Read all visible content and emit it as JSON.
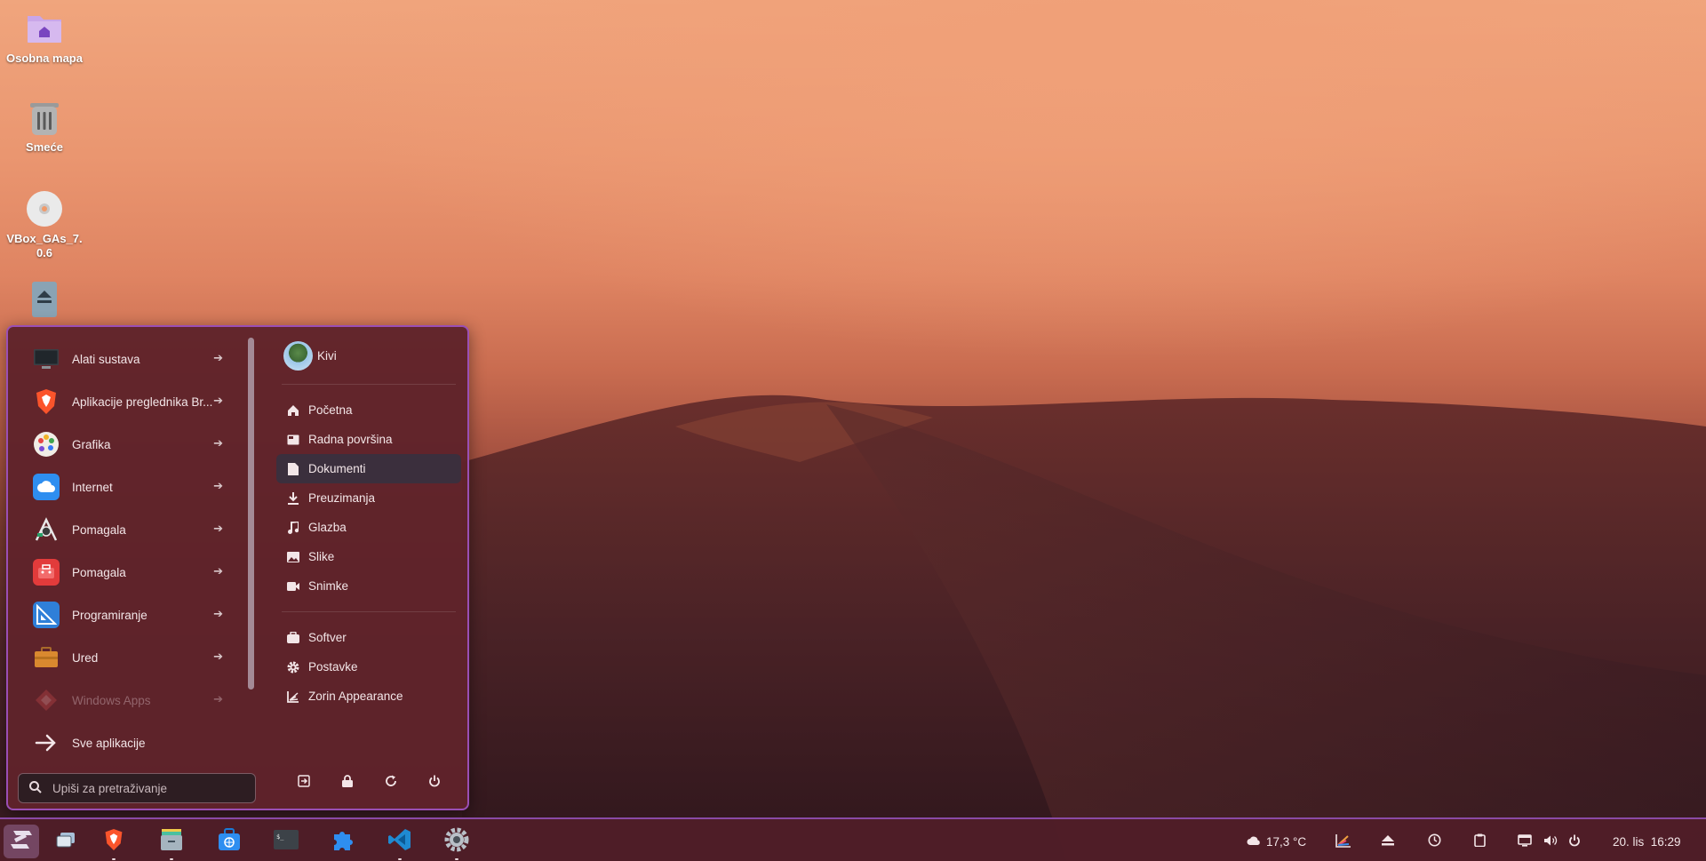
{
  "desktop": {
    "icons": [
      {
        "label": "Osobna mapa",
        "icon": "home-folder-icon"
      },
      {
        "label": "Smeće",
        "icon": "trash-icon"
      },
      {
        "label": "VBox_GAs_7.\n0.6",
        "icon": "disc-icon"
      },
      {
        "label": "",
        "icon": "eject-drive-icon"
      }
    ]
  },
  "menu": {
    "categories": [
      {
        "label": "Alati sustava",
        "icon": "monitor-icon"
      },
      {
        "label": "Aplikacije preglednika Br...",
        "icon": "brave-icon"
      },
      {
        "label": "Grafika",
        "icon": "palette-icon"
      },
      {
        "label": "Internet",
        "icon": "cloud-icon"
      },
      {
        "label": "Pomagala",
        "icon": "accessibility-tools-icon"
      },
      {
        "label": "Pomagala",
        "icon": "toolbox-icon"
      },
      {
        "label": "Programiranje",
        "icon": "ruler-triangle-icon"
      },
      {
        "label": "Ured",
        "icon": "briefcase-icon"
      },
      {
        "label": "Windows Apps",
        "icon": "windows-apps-icon"
      }
    ],
    "all_apps_label": "Sve aplikacije",
    "search_placeholder": "Upiši za pretraživanje",
    "user_name": "Kivi",
    "places": [
      {
        "label": "Početna",
        "icon": "home-icon"
      },
      {
        "label": "Radna površina",
        "icon": "desktop-icon"
      },
      {
        "label": "Dokumenti",
        "icon": "document-icon"
      },
      {
        "label": "Preuzimanja",
        "icon": "download-icon"
      },
      {
        "label": "Glazba",
        "icon": "music-icon"
      },
      {
        "label": "Slike",
        "icon": "image-icon"
      },
      {
        "label": "Snimke",
        "icon": "video-icon"
      }
    ],
    "system": [
      {
        "label": "Softver",
        "icon": "bag-icon"
      },
      {
        "label": "Postavke",
        "icon": "gear-icon"
      },
      {
        "label": "Zorin Appearance",
        "icon": "appearance-icon"
      }
    ]
  },
  "taskbar": {
    "weather": "17,3 °C",
    "datetime": "20. lis  16:29"
  },
  "colors": {
    "menu_border": "#9a4fb5",
    "menu_bg": "#5f232a",
    "active_item": "#3b2f3d"
  }
}
